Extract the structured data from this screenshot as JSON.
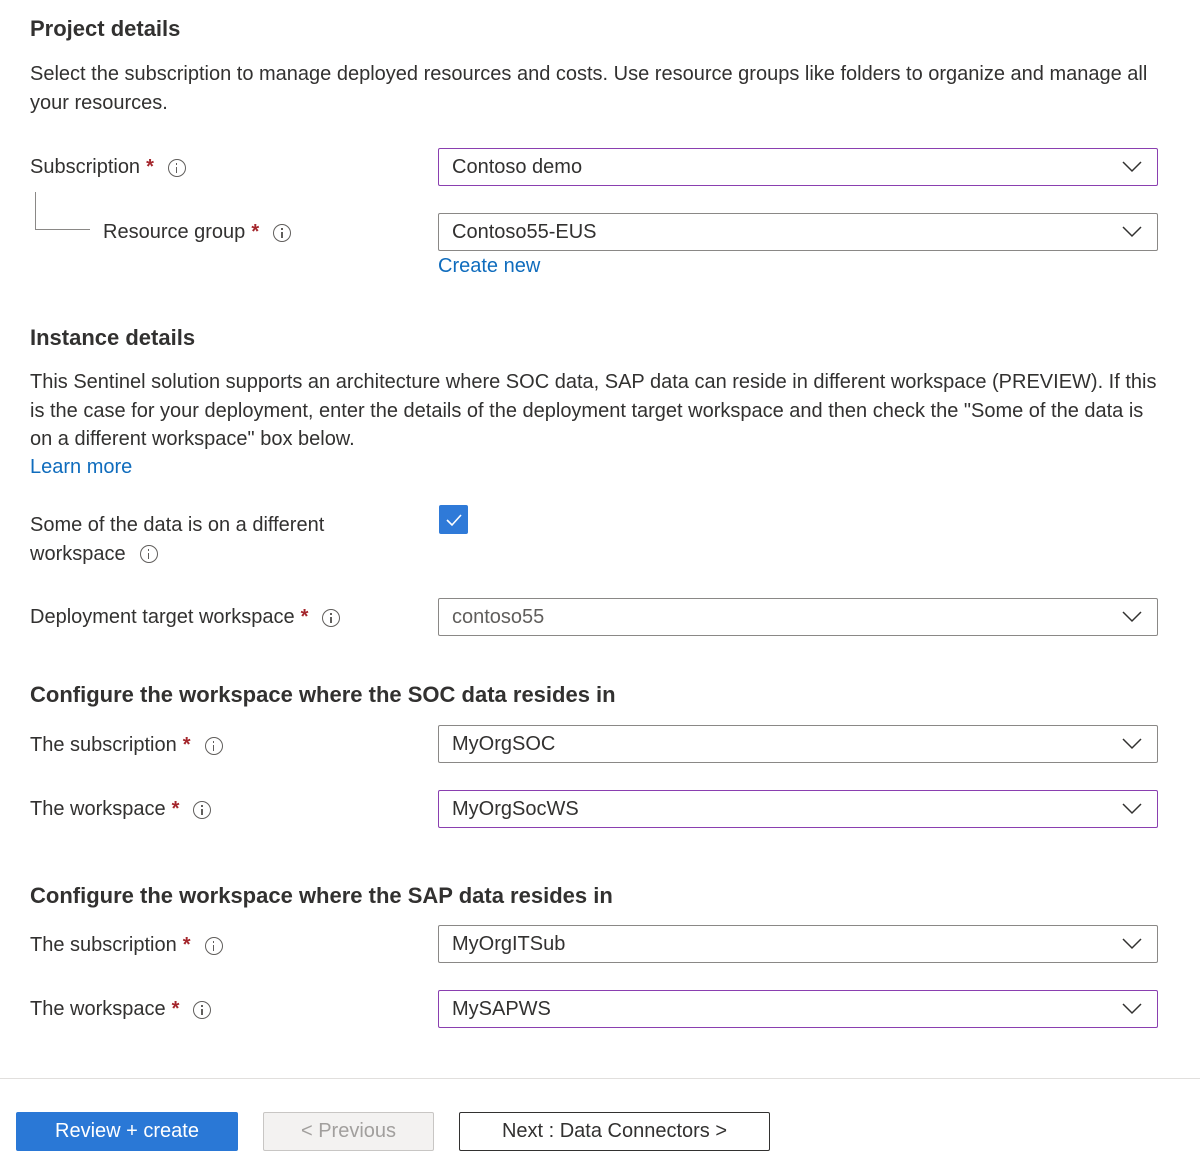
{
  "project": {
    "heading": "Project details",
    "description": "Select the subscription to manage deployed resources and costs. Use resource groups like folders to organize and manage all your resources.",
    "subscription": {
      "label": "Subscription",
      "required": "*",
      "value": "Contoso demo"
    },
    "resource_group": {
      "label": "Resource group",
      "required": "*",
      "value": "Contoso55-EUS",
      "create_new": "Create new"
    }
  },
  "instance": {
    "heading": "Instance details",
    "description": "This Sentinel solution supports an architecture where SOC data, SAP data can reside in different workspace (PREVIEW). If this is the case for your deployment, enter the details of the deployment target workspace and then check the \"Some of the data is on a different workspace\" box below.",
    "learn_more": "Learn more",
    "different_workspace": {
      "label_line1": "Some of the data is on a different",
      "label_line2": "workspace",
      "checked": true
    },
    "target_workspace": {
      "label": "Deployment target workspace",
      "required": "*",
      "value": "contoso55"
    }
  },
  "soc": {
    "heading": "Configure the workspace where the SOC data resides in",
    "subscription": {
      "label": "The subscription",
      "required": "*",
      "value": "MyOrgSOC"
    },
    "workspace": {
      "label": "The workspace",
      "required": "*",
      "value": "MyOrgSocWS"
    }
  },
  "sap": {
    "heading": "Configure the workspace where the SAP data resides in",
    "subscription": {
      "label": "The subscription",
      "required": "*",
      "value": "MyOrgITSub"
    },
    "workspace": {
      "label": "The workspace",
      "required": "*",
      "value": "MySAPWS"
    }
  },
  "footer": {
    "review_create": "Review + create",
    "previous": "< Previous",
    "next": "Next : Data Connectors >"
  },
  "colors": {
    "accent": "#2a78d6",
    "focus_border": "#8a3fb0",
    "required": "#a4262c",
    "link": "#0f6cbd"
  }
}
